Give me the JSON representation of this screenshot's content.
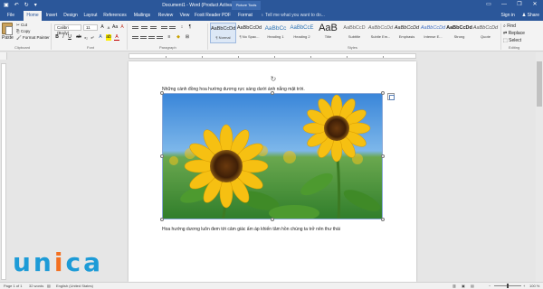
{
  "window": {
    "title": "Document1 - Word (Product Activation Failed)",
    "contextual_label": "Picture Tools",
    "controls": [
      "—",
      "❐",
      "✕"
    ]
  },
  "tabs": [
    {
      "label": "File"
    },
    {
      "label": "Home",
      "active": true
    },
    {
      "label": "Insert"
    },
    {
      "label": "Design"
    },
    {
      "label": "Layout"
    },
    {
      "label": "References"
    },
    {
      "label": "Mailings"
    },
    {
      "label": "Review"
    },
    {
      "label": "View"
    },
    {
      "label": "Foxit Reader PDF"
    },
    {
      "label": "Format"
    }
  ],
  "tell_me": "Tell me what you want to do...",
  "account": {
    "sign_in": "Sign in",
    "share": "Share"
  },
  "clipboard": {
    "paste": "Paste",
    "cut": "Cut",
    "copy": "Copy",
    "format_painter": "Format Painter",
    "group_label": "Clipboard"
  },
  "font": {
    "name": "Calibri (Body)",
    "size": "11",
    "group_label": "Font"
  },
  "paragraph": {
    "group_label": "Paragraph"
  },
  "styles": {
    "items": [
      {
        "sample": "AaBbCcDd",
        "name": "¶ Normal",
        "selected": true
      },
      {
        "sample": "AaBbCcDd",
        "name": "¶ No Spac..."
      },
      {
        "sample": "AaBbCc",
        "name": "Heading 1"
      },
      {
        "sample": "AaBbCcE",
        "name": "Heading 2"
      },
      {
        "sample": "AaB",
        "name": "Title"
      },
      {
        "sample": "AaBbCcD",
        "name": "Subtitle"
      },
      {
        "sample": "AaBbCcDd",
        "name": "Subtle Em..."
      },
      {
        "sample": "AaBbCcDd",
        "name": "Emphasis"
      },
      {
        "sample": "AaBbCcDd",
        "name": "Intense E..."
      },
      {
        "sample": "AaBbCcDd",
        "name": "Strong"
      },
      {
        "sample": "AaBbCcDd",
        "name": "Quote"
      }
    ],
    "group_label": "Styles"
  },
  "editing": {
    "find": "Find",
    "replace": "Replace",
    "select": "Select",
    "group_label": "Editing"
  },
  "document": {
    "paragraph1": "Những cánh đồng hoa hướng dương rực sáng dưới ánh nắng mặt trời.",
    "paragraph2": "Hoa hướng dương luôn đem tới cảm giác ấm áp khiến tâm hồn chúng ta trở nên thư thái"
  },
  "status": {
    "page": "Page 1 of 1",
    "words": "32 words",
    "language": "English (United States)",
    "zoom": "100 %"
  },
  "logo": {
    "text_blue": "un",
    "text_orange": "i",
    "text_blue2": "ca"
  },
  "colors": {
    "accent": "#2b579a",
    "logo_blue": "#1d9bd7",
    "logo_orange": "#f37021"
  }
}
